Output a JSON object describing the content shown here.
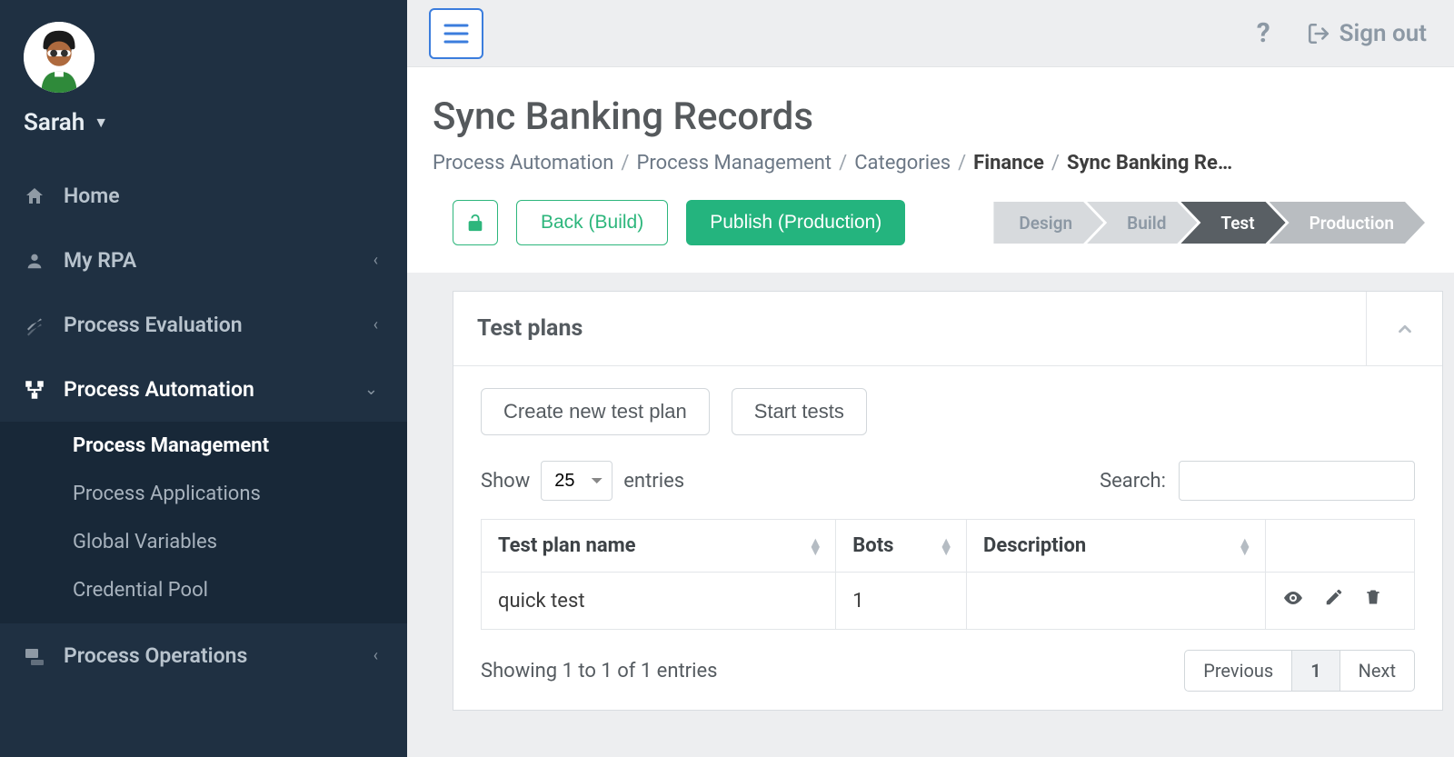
{
  "user": {
    "name": "Sarah"
  },
  "sidebar": {
    "items": [
      {
        "key": "home",
        "label": "Home"
      },
      {
        "key": "my-rpa",
        "label": "My RPA"
      },
      {
        "key": "process-evaluation",
        "label": "Process Evaluation"
      },
      {
        "key": "process-automation",
        "label": "Process Automation"
      },
      {
        "key": "process-operations",
        "label": "Process Operations"
      }
    ],
    "automation_children": [
      {
        "key": "process-management",
        "label": "Process Management"
      },
      {
        "key": "process-applications",
        "label": "Process Applications"
      },
      {
        "key": "global-variables",
        "label": "Global Variables"
      },
      {
        "key": "credential-pool",
        "label": "Credential Pool"
      }
    ]
  },
  "topbar": {
    "signout_label": "Sign out"
  },
  "page": {
    "title": "Sync Banking Records",
    "breadcrumb": {
      "c1": "Process Automation",
      "c2": "Process Management",
      "c3": "Categories",
      "c4": "Finance",
      "c5": "Sync Banking Re…"
    }
  },
  "stage": {
    "back_label": "Back (Build)",
    "publish_label": "Publish (Production)",
    "steps": {
      "design": "Design",
      "build": "Build",
      "test": "Test",
      "production": "Production"
    }
  },
  "panel": {
    "title": "Test plans",
    "actions": {
      "create": "Create new test plan",
      "start": "Start tests"
    },
    "show_label": "Show",
    "entries_label": "entries",
    "page_size": "25",
    "search_label": "Search:",
    "search_value": "",
    "columns": {
      "name": "Test plan name",
      "bots": "Bots",
      "description": "Description"
    },
    "rows": [
      {
        "name": "quick test",
        "bots": "1",
        "description": ""
      }
    ],
    "info_text": "Showing 1 to 1 of 1 entries",
    "pager": {
      "prev": "Previous",
      "page": "1",
      "next": "Next"
    }
  }
}
